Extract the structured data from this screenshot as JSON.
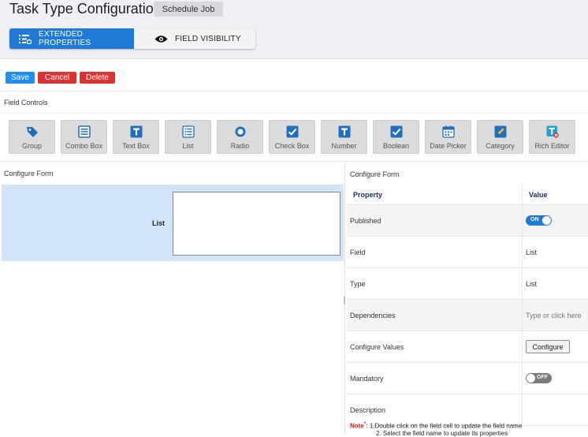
{
  "header": {
    "title": "Task Type Configuration",
    "schedule_button": "Schedule Job"
  },
  "tabs": [
    {
      "label": "EXTENDED PROPERTIES",
      "icon": "list-settings-icon",
      "active": true
    },
    {
      "label": "FIELD VISIBILITY",
      "icon": "eye-icon",
      "active": false
    }
  ],
  "actions": {
    "save": "Save",
    "cancel": "Cancel",
    "delete": "Delete"
  },
  "field_controls": {
    "heading": "Field Controls",
    "items": [
      {
        "label": "Group",
        "icon": "tag-icon"
      },
      {
        "label": "Combo Box",
        "icon": "combo-box-icon"
      },
      {
        "label": "Text Box",
        "icon": "text-t-icon"
      },
      {
        "label": "List",
        "icon": "list-icon"
      },
      {
        "label": "Radio",
        "icon": "radio-icon"
      },
      {
        "label": "Check Box",
        "icon": "checkbox-icon"
      },
      {
        "label": "Number",
        "icon": "number-t-icon"
      },
      {
        "label": "Boolean",
        "icon": "boolean-check-icon"
      },
      {
        "label": "Date Picker",
        "icon": "calendar-icon"
      },
      {
        "label": "Category",
        "icon": "category-pencil-icon"
      },
      {
        "label": "Rich Editor",
        "icon": "rich-editor-icon"
      }
    ]
  },
  "form": {
    "heading": "Configure Form",
    "field_label": "List"
  },
  "properties": {
    "heading": "Configure Form",
    "col_property": "Property",
    "col_value": "Value",
    "rows": {
      "published": {
        "label": "Published",
        "toggle": "ON",
        "on": true
      },
      "field": {
        "label": "Field",
        "value": "List"
      },
      "type": {
        "label": "Type",
        "value": "List"
      },
      "dependencies": {
        "label": "Dependencies",
        "placeholder": "Type or click here"
      },
      "configure_values": {
        "label": "Configure Values",
        "button": "Configure"
      },
      "mandatory": {
        "label": "Mandatory",
        "toggle": "OFF",
        "on": false
      },
      "description": {
        "label": "Description",
        "value": ""
      }
    }
  },
  "note": {
    "label": "Note",
    "asterisk": "*",
    "line1": ": 1.Double click on the field cell to update the field name",
    "line2": "2. Select the field name to update its properties"
  },
  "colors": {
    "primary": "#1f7ad6",
    "save": "#1f8ef0",
    "danger": "#dc3232",
    "selected_row": "#d3e5f8"
  }
}
